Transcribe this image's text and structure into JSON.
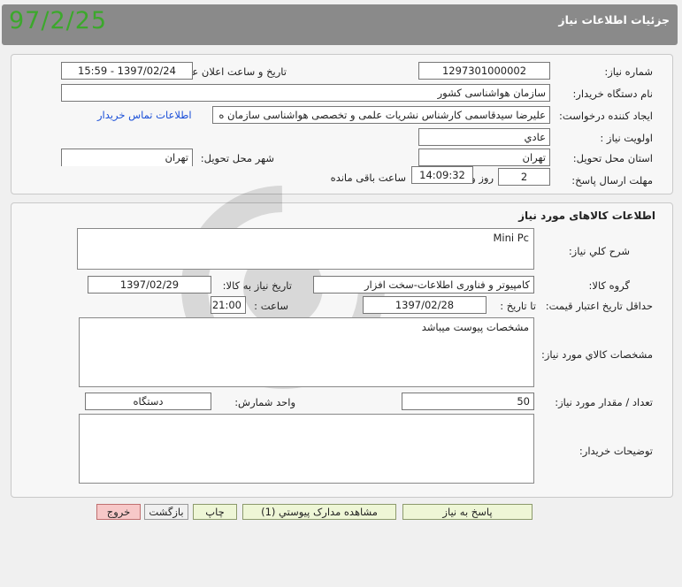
{
  "header": {
    "title": "جزئیات اطلاعات نیاز",
    "stamp_date": "97/2/25"
  },
  "info": {
    "need_number_label": "شماره نیاز:",
    "need_number": "1297301000002",
    "announce_label": "تاریخ و ساعت اعلان عمومی:",
    "announce_value": "1397/02/24 - 15:59",
    "buyer_org_label": "نام دستگاه خریدار:",
    "buyer_org": "سازمان هواشناسی کشور",
    "creator_label": "ایجاد کننده درخواست:",
    "creator": "علیرضا سیدقاسمی کارشناس نشریات علمی و تخصصی هواشناسی سازمان ه",
    "contact_link": "اطلاعات تماس خریدار",
    "priority_label": "اولویت نیاز :",
    "priority": "عادي",
    "province_label": "استان محل تحویل:",
    "province": "تهران",
    "city_label": "شهر محل تحویل:",
    "city": "تهران",
    "deadline_label": "مهلت ارسال پاسخ:",
    "deadline_days": "2",
    "days_label": "روز و",
    "deadline_time": "14:09:32",
    "remaining_label": "ساعت باقی مانده"
  },
  "goods": {
    "section_title": "اطلاعات کالاهای مورد نیاز",
    "summary_label": "شرح کلي نیاز:",
    "summary": "Mini Pc",
    "group_label": "گروه کالا:",
    "group": "کامپیوتر و فناوری اطلاعات-سخت افزار",
    "need_date_label": "تاریخ نیاز به کالا:",
    "need_date": "1397/02/29",
    "validity_label": "حداقل تاریخ اعتبار قیمت:",
    "until_label": "تا تاریخ :",
    "validity_date": "1397/02/28",
    "time_label": "ساعت :",
    "validity_time": "21:00",
    "specs_label": "مشخصات کالاي مورد نیاز:",
    "specs": "مشخصات پیوست میباشد",
    "qty_label": "تعداد / مقدار مورد نیاز:",
    "qty": "50",
    "unit_label": "واحد شمارش:",
    "unit": "دستگاه",
    "buyer_notes_label": "توضیحات خریدار:",
    "buyer_notes": ""
  },
  "buttons": {
    "reply": "پاسخ به نیاز",
    "attachments": "مشاهده مدارک پیوستي (1)",
    "print": "چاپ",
    "back": "بازگشت",
    "exit": "خروج"
  },
  "colors": {
    "header_bg": "#8a8a8a",
    "stamp": "#3ca82c",
    "link": "#1a4fd8"
  }
}
